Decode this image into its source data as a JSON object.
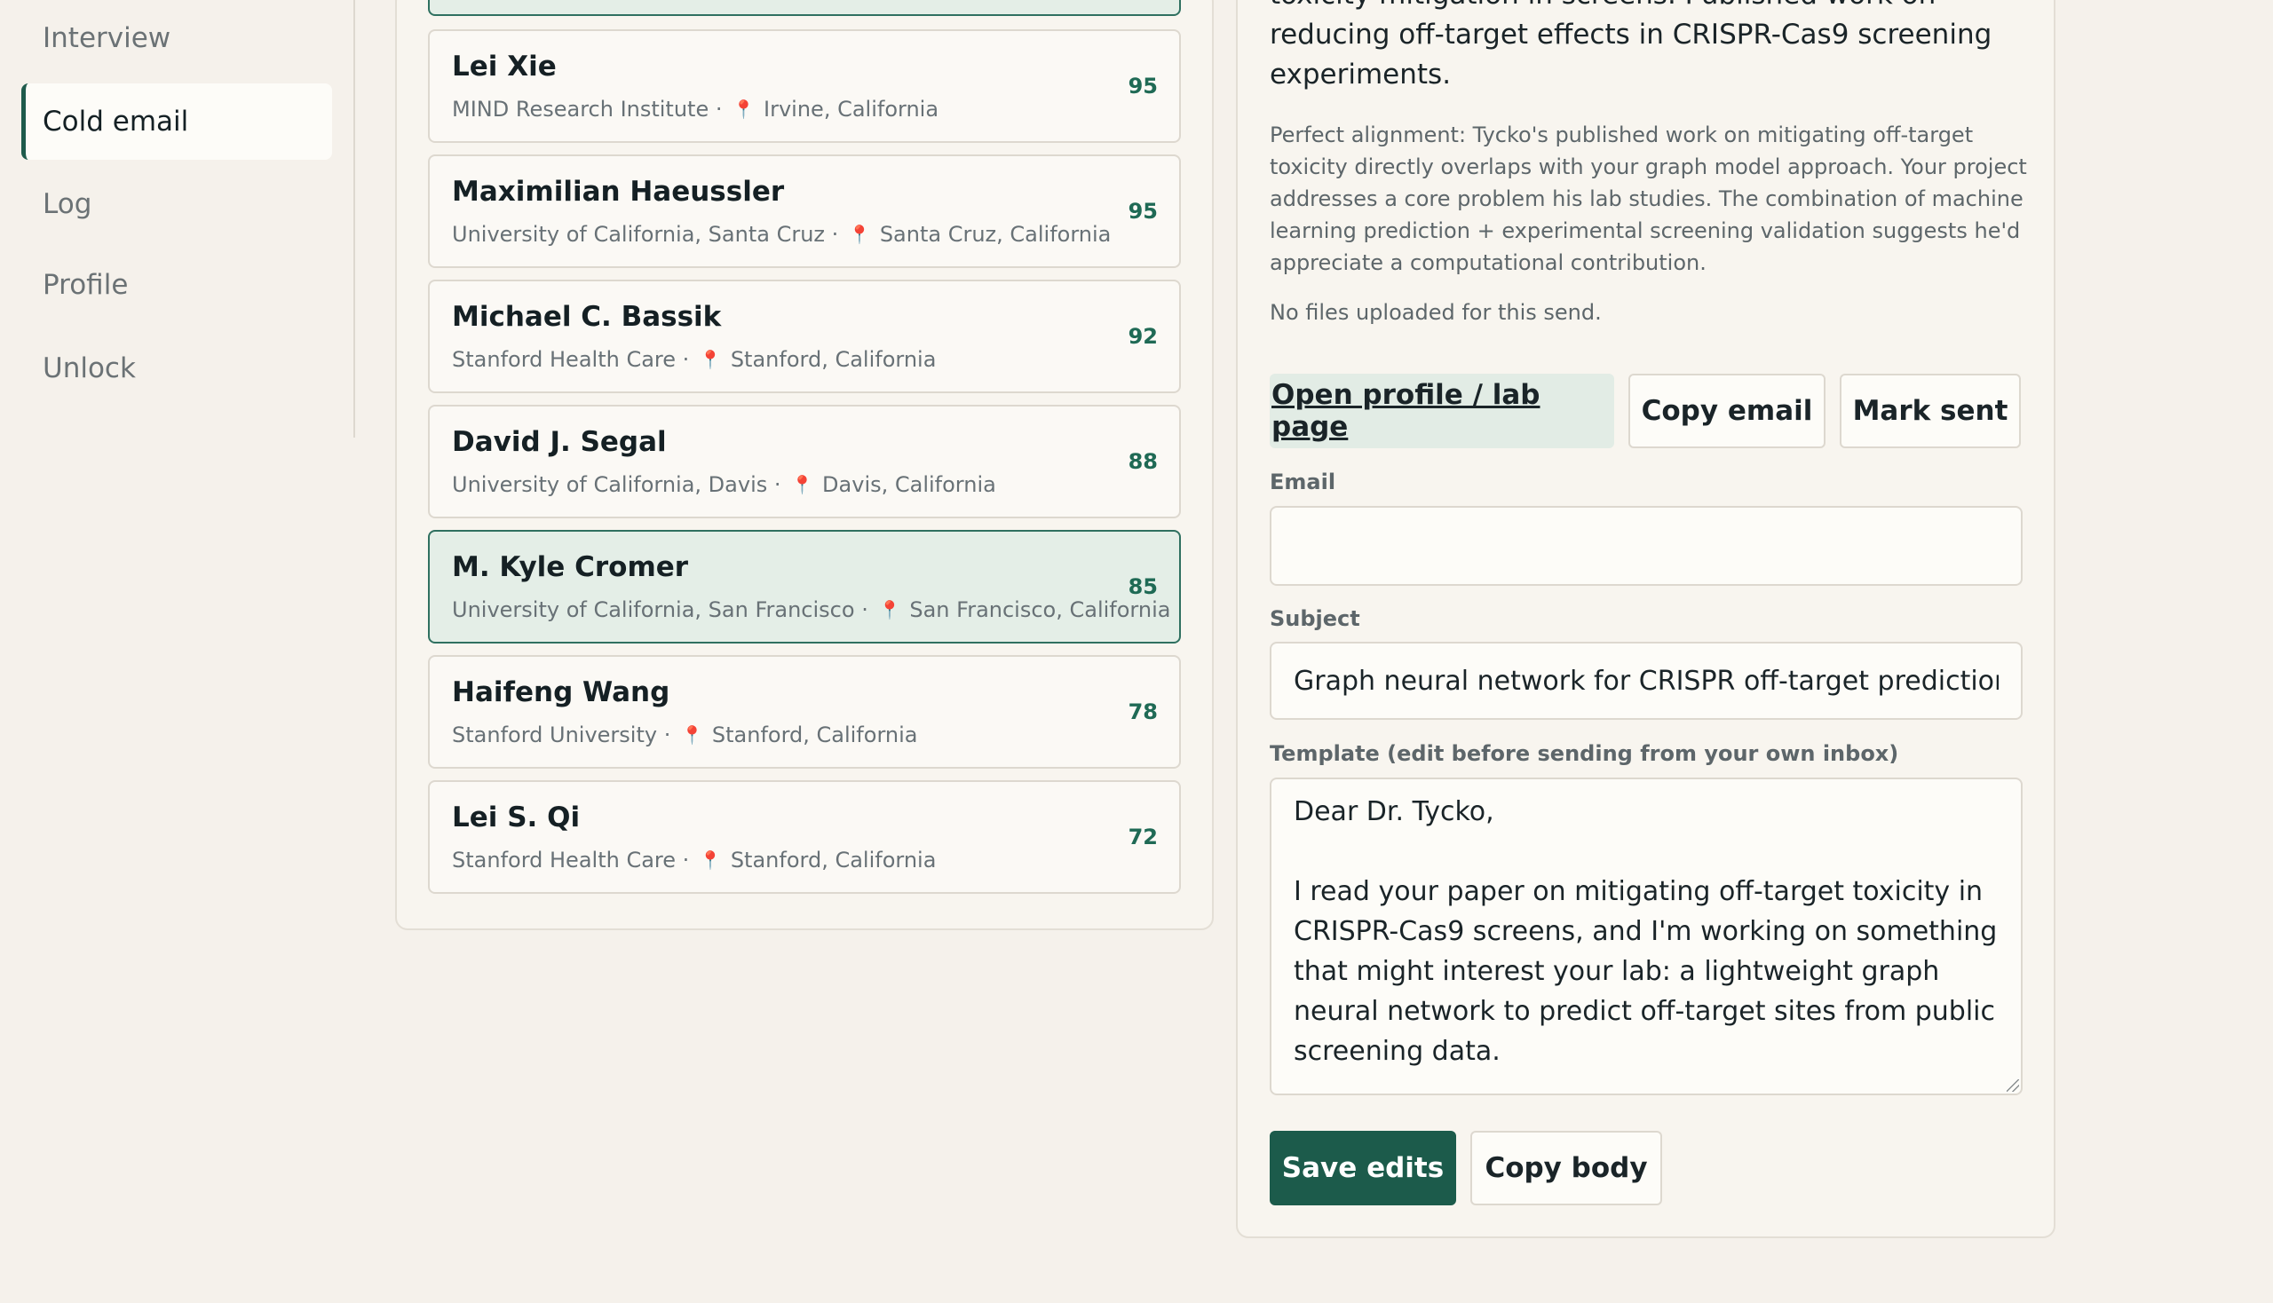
{
  "sidebar": {
    "items": [
      {
        "label": "Interview",
        "active": false
      },
      {
        "label": "Cold email",
        "active": true
      },
      {
        "label": "Log",
        "active": false
      },
      {
        "label": "Profile",
        "active": false
      },
      {
        "label": "Unlock",
        "active": false
      }
    ]
  },
  "matches": [
    {
      "name": "Lei Xie",
      "institution": "MIND Research Institute",
      "location": "Irvine, California",
      "score": "95"
    },
    {
      "name": "Maximilian Haeussler",
      "institution": "University of California, Santa Cruz",
      "location": "Santa Cruz, California",
      "score": "95"
    },
    {
      "name": "Michael C. Bassik",
      "institution": "Stanford Health Care",
      "location": "Stanford, California",
      "score": "92"
    },
    {
      "name": "David J. Segal",
      "institution": "University of California, Davis",
      "location": "Davis, California",
      "score": "88"
    },
    {
      "name": "M. Kyle Cromer",
      "institution": "University of California, San Francisco",
      "location": "San Francisco, California",
      "score": "85",
      "selected": true
    },
    {
      "name": "Haifeng Wang",
      "institution": "Stanford University",
      "location": "Stanford, California",
      "score": "78"
    },
    {
      "name": "Lei S. Qi",
      "institution": "Stanford Health Care",
      "location": "Stanford, California",
      "score": "72"
    }
  ],
  "detail": {
    "summary": "toxicity mitigation in screens. Published work on reducing off-target effects in CRISPR-Cas9 screening experiments.",
    "rationale": "Perfect alignment: Tycko's published work on mitigating off-target toxicity directly overlaps with your graph model approach. Your project addresses a core problem his lab studies. The combination of machine learning prediction + experimental screening validation suggests he'd appreciate a computational contribution.",
    "files_note": "No files uploaded for this send.",
    "actions": {
      "open_profile": "Open profile / lab page",
      "copy_email": "Copy email",
      "mark_sent": "Mark sent"
    },
    "email_label": "Email",
    "email_value": "",
    "subject_label": "Subject",
    "subject_value": "Graph neural network for CRISPR off-target prediction",
    "template_label": "Template (edit before sending from your own inbox)",
    "template_body": "Dear Dr. Tycko,\n\nI read your paper on mitigating off-target toxicity in CRISPR-Cas9 screens, and I'm working on something that might interest your lab: a lightweight graph neural network to predict off-target sites from public screening data.",
    "save_label": "Save edits",
    "copy_body_label": "Copy body"
  },
  "colors": {
    "accent": "#1c5b4b",
    "score": "#1f6a55",
    "pin": "#d14a4a",
    "background": "#f5f1eb"
  }
}
